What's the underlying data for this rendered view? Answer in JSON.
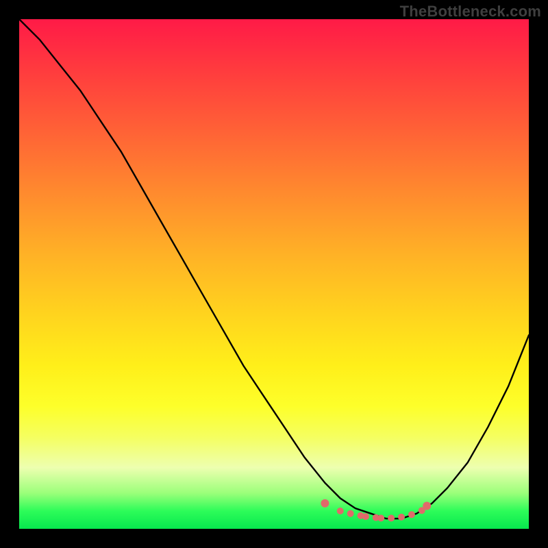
{
  "watermark": "TheBottleneck.com",
  "chart_data": {
    "type": "line",
    "title": "",
    "xlabel": "",
    "ylabel": "",
    "xlim": [
      0,
      100
    ],
    "ylim": [
      0,
      100
    ],
    "grid": false,
    "legend": false,
    "series": [
      {
        "name": "curve",
        "color": "#000000",
        "x": [
          0,
          4,
          8,
          12,
          16,
          20,
          24,
          28,
          32,
          36,
          40,
          44,
          48,
          52,
          56,
          60,
          63,
          66,
          69,
          72,
          75,
          78,
          81,
          84,
          88,
          92,
          96,
          100
        ],
        "y": [
          100,
          96,
          91,
          86,
          80,
          74,
          67,
          60,
          53,
          46,
          39,
          32,
          26,
          20,
          14,
          9,
          6,
          4,
          3,
          2,
          2,
          3,
          5,
          8,
          13,
          20,
          28,
          38
        ]
      },
      {
        "name": "bottom-dots",
        "color": "#e06a6a",
        "style": "markers",
        "x": [
          60,
          63,
          65,
          67,
          68,
          70,
          71,
          73,
          75,
          77,
          79,
          80
        ],
        "y": [
          5,
          3.5,
          3,
          2.6,
          2.4,
          2.2,
          2.1,
          2.1,
          2.3,
          2.8,
          3.6,
          4.5
        ]
      }
    ],
    "colors": {
      "gradient_top": "#ff1a47",
      "gradient_mid": "#ffd41e",
      "gradient_bottom": "#07e84e",
      "frame": "#000000",
      "dot": "#e06a6a"
    }
  }
}
